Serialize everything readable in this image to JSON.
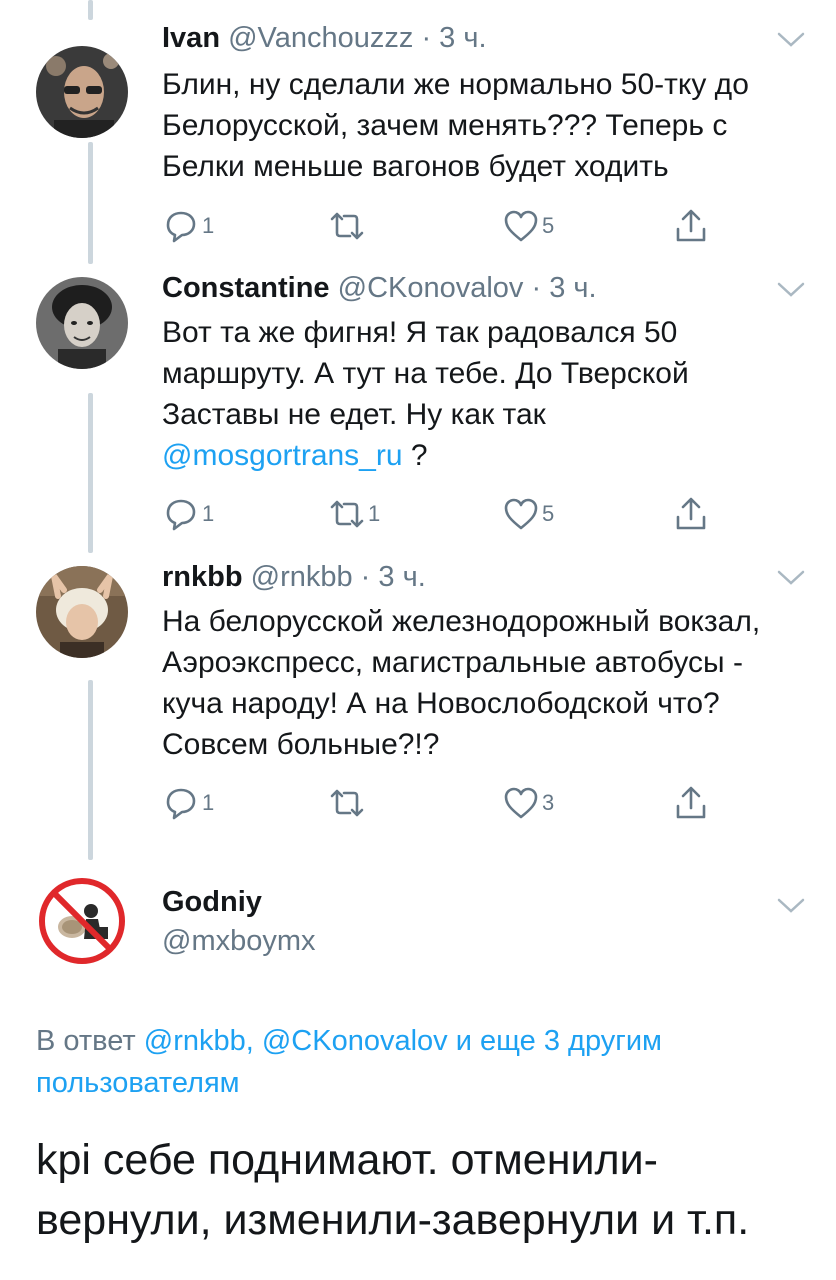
{
  "tweets": [
    {
      "name": "Ivan",
      "handle": "@Vanchouzzz",
      "dot": "·",
      "time": "3 ч.",
      "text": "Блин, ну сделали же нормально 50-тку до Белорусской, зачем менять??? Теперь с Белки меньше вагонов будет ходить",
      "reply_count": "1",
      "retweet_count": "",
      "like_count": "5"
    },
    {
      "name": "Constantine",
      "handle": "@CKonovalov",
      "dot": "·",
      "time": "3 ч.",
      "text_before": "Вот та же фигня! Я так радовался 50 маршруту. А тут на тебе. До Тверской Заставы не едет. Ну как так",
      "mention": "@mosgortrans_ru",
      "text_after": " ?",
      "reply_count": "1",
      "retweet_count": "1",
      "like_count": "5"
    },
    {
      "name": "rnkbb",
      "handle": "@rnkbb",
      "dot": "·",
      "time": "3 ч.",
      "text": "На белорусской железнодорожный вокзал, Аэроэкспресс, магистральные автобусы - куча народу! А на Новослободской что? Совсем больные?!?",
      "reply_count": "1",
      "retweet_count": "",
      "like_count": "3"
    }
  ],
  "main_tweet": {
    "name": "Godniy",
    "handle": "@mxboymx",
    "reply_prefix": "В ответ ",
    "reply_mentions": "@rnkbb, @CKonovalov и еще 3 другим пользователям",
    "text": "kpi себе поднимают. отменили-вернули, изменили-завернули и т.п."
  },
  "colors": {
    "accent": "#1da1f2",
    "secondary_text": "#657786",
    "thread_line": "#ccd6dd"
  },
  "icons": [
    "reply-icon",
    "retweet-icon",
    "like-icon",
    "share-icon",
    "chevron-down-icon"
  ]
}
